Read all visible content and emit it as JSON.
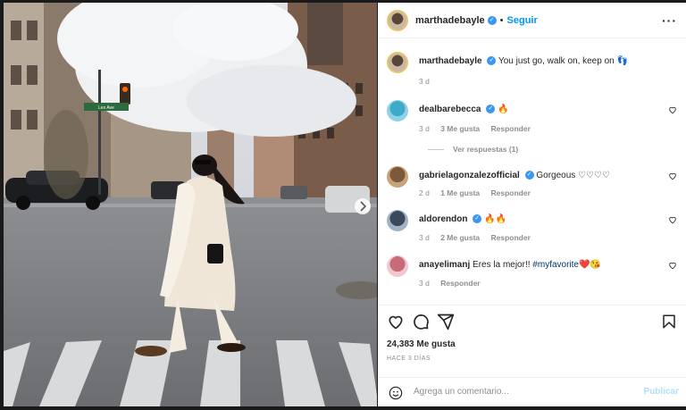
{
  "post": {
    "username": "marthadebayle",
    "follow_label": "Seguir",
    "caption": "You just go, walk on, keep on",
    "caption_emoji": "👣",
    "caption_time": "3 d"
  },
  "comments": [
    {
      "user": "dealbarebecca",
      "text": "🔥",
      "time": "3 d",
      "likes": "3 Me gusta",
      "reply": "Responder",
      "verified": true,
      "view_replies": "Ver respuestas (1)"
    },
    {
      "user": "gabrielagonzalezofficial",
      "text": "Gorgeous ♡♡♡♡",
      "time": "2 d",
      "likes": "1 Me gusta",
      "reply": "Responder",
      "verified": true
    },
    {
      "user": "aldorendon",
      "text": "🔥🔥",
      "time": "3 d",
      "likes": "2 Me gusta",
      "reply": "Responder",
      "verified": true
    },
    {
      "user": "anayelimanj",
      "text_before": "Eres la mejor!! ",
      "hashtag": "#myfavorite",
      "text_after": "❤️😘",
      "time": "3 d",
      "reply": "Responder",
      "verified": false
    }
  ],
  "actions": {
    "likes": "24,383 Me gusta",
    "ago": "HACE 3 DÍAS",
    "comment_placeholder": "Agrega un comentario...",
    "publish": "Publicar"
  },
  "photo": {
    "street_sign": "Lex Ave"
  },
  "colors": {
    "accent": "#0095f6",
    "verified": "#3897f0",
    "muted": "#8e8e8e"
  }
}
